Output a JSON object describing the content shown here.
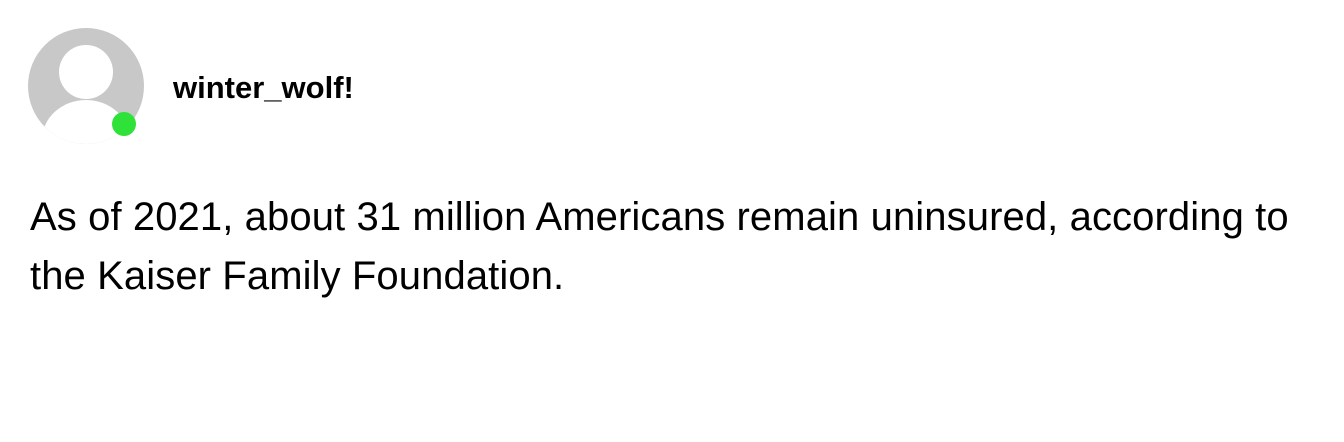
{
  "post": {
    "author": {
      "username": "winter_wolf!",
      "avatar_icon": "default-user-avatar-icon",
      "online": true,
      "status_color": "#2fe23a"
    },
    "text": "As of 2021, about 31 million Americans remain uninsured, according to the Kaiser Family Foundation."
  }
}
